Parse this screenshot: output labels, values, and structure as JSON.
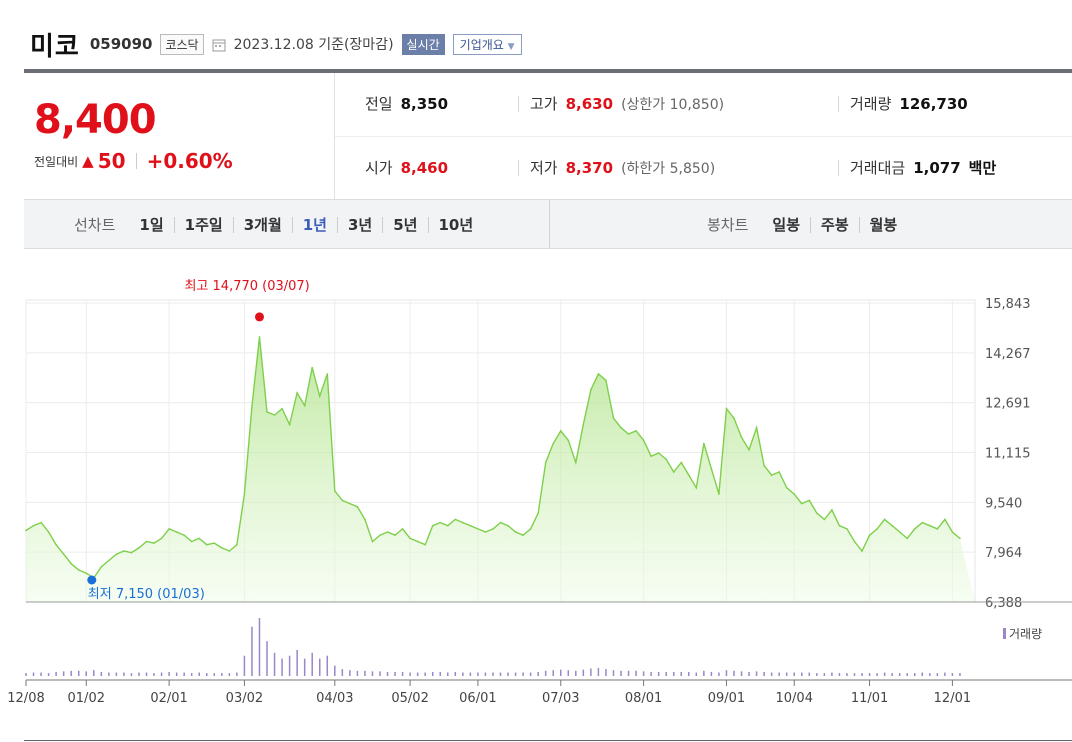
{
  "header": {
    "name": "미코",
    "code": "059090",
    "market": "코스닥",
    "date_text": "2023.12.08 기준(장마감)",
    "realtime_label": "실시간",
    "overview_label": "기업개요",
    "calendar_icon": "calendar-icon",
    "dropdown_icon": "chevron-down-icon"
  },
  "quote": {
    "price": "8,400",
    "change_label": "전일대비",
    "change_dir": "▲",
    "change": "50",
    "change_pct": "+0.60%",
    "prev_close_label": "전일",
    "prev_close": "8,350",
    "open_label": "시가",
    "open": "8,460",
    "high_label": "고가",
    "high": "8,630",
    "upper_limit": "(상한가 10,850)",
    "low_label": "저가",
    "low": "8,370",
    "lower_limit": "(하한가 5,850)",
    "volume_label": "거래량",
    "volume": "126,730",
    "value_label": "거래대금",
    "value": "1,077",
    "value_unit": "백만"
  },
  "tabs": {
    "line_label": "선차트",
    "line_periods": [
      "1일",
      "1주일",
      "3개월",
      "1년",
      "3년",
      "5년",
      "10년"
    ],
    "active_period": "1년",
    "candle_label": "봉차트",
    "candle_periods": [
      "일봉",
      "주봉",
      "월봉"
    ]
  },
  "colors": {
    "up": "#e0101a",
    "accent": "#3b5cb8",
    "line": "#7ed04a",
    "volume": "#9a86c8",
    "min_marker": "#1a6fd6"
  },
  "chart_data": {
    "type": "area",
    "y_ticks": [
      "15,843",
      "14,267",
      "12,691",
      "11,115",
      "9,540",
      "7,964",
      "6,388"
    ],
    "ylim": [
      6388,
      15843
    ],
    "x_tick_labels": [
      "12/08",
      "01/02",
      "02/01",
      "03/02",
      "04/03",
      "05/02",
      "06/01",
      "07/03",
      "08/01",
      "09/01",
      "10/04",
      "11/01",
      "12/01"
    ],
    "x": [
      "12/08",
      "12/12",
      "12/14",
      "12/16",
      "12/20",
      "12/22",
      "12/26",
      "12/28",
      "01/02",
      "01/03",
      "01/05",
      "01/09",
      "01/11",
      "01/13",
      "01/17",
      "01/19",
      "01/25",
      "01/27",
      "01/31",
      "02/02",
      "02/06",
      "02/08",
      "02/10",
      "02/14",
      "02/16",
      "02/20",
      "02/22",
      "02/24",
      "02/27",
      "03/02",
      "03/06",
      "03/07",
      "03/09",
      "03/13",
      "03/15",
      "03/17",
      "03/21",
      "03/23",
      "03/27",
      "03/29",
      "03/31",
      "04/04",
      "04/06",
      "04/10",
      "04/12",
      "04/14",
      "04/18",
      "04/20",
      "04/24",
      "04/26",
      "04/28",
      "05/03",
      "05/08",
      "05/10",
      "05/12",
      "05/16",
      "05/18",
      "05/22",
      "05/25",
      "05/30",
      "06/01",
      "06/05",
      "06/08",
      "06/12",
      "06/14",
      "06/16",
      "06/20",
      "06/22",
      "06/26",
      "06/28",
      "06/30",
      "07/03",
      "07/05",
      "07/07",
      "07/11",
      "07/13",
      "07/17",
      "07/19",
      "07/21",
      "07/25",
      "07/27",
      "07/31",
      "08/02",
      "08/04",
      "08/08",
      "08/10",
      "08/14",
      "08/17",
      "08/21",
      "08/23",
      "08/25",
      "08/29",
      "08/31",
      "09/04",
      "09/06",
      "09/08",
      "09/12",
      "09/14",
      "09/18",
      "09/20",
      "09/22",
      "09/26",
      "10/04",
      "10/06",
      "10/10",
      "10/12",
      "10/16",
      "10/18",
      "10/20",
      "10/24",
      "10/26",
      "10/30",
      "11/01",
      "11/03",
      "11/07",
      "11/09",
      "11/13",
      "11/15",
      "11/17",
      "11/21",
      "11/23",
      "11/27",
      "11/29",
      "12/01",
      "12/05",
      "12/07",
      "12/08"
    ],
    "series": [
      {
        "values": [
          8650,
          8800,
          8900,
          8600,
          8200,
          7900,
          7600,
          7400,
          7300,
          7150,
          7500,
          7700,
          7900,
          8000,
          7950,
          8100,
          8300,
          8250,
          8400,
          8700,
          8600,
          8500,
          8300,
          8400,
          8200,
          8250,
          8100,
          8000,
          8200,
          9800,
          12600,
          14770,
          12400,
          12300,
          12500,
          12000,
          13000,
          12600,
          13800,
          12900,
          13600,
          9900,
          9600,
          9500,
          9400,
          9000,
          8300,
          8500,
          8600,
          8500,
          8700,
          8400,
          8300,
          8200,
          8800,
          8900,
          8800,
          9000,
          8900,
          8800,
          8700,
          8600,
          8700,
          8900,
          8800,
          8600,
          8500,
          8700,
          9200,
          10800,
          11400,
          11800,
          11500,
          10800,
          12000,
          13100,
          13600,
          13400,
          12200,
          11900,
          11700,
          11800,
          11500,
          11000,
          11100,
          10900,
          10500,
          10800,
          10400,
          10000,
          11400,
          10600,
          9800,
          12500,
          12200,
          11600,
          11200,
          11900,
          10700,
          10400,
          10500,
          10000,
          9800,
          9500,
          9600,
          9200,
          9000,
          9300,
          8800,
          8700,
          8300,
          8000,
          8500,
          8700,
          9000,
          8800,
          8600,
          8400,
          8700,
          8900,
          8800,
          8700,
          9000,
          8600,
          8400
        ]
      }
    ],
    "volume_series_name": "거래량",
    "volume_values": [
      5,
      6,
      6,
      5,
      7,
      8,
      9,
      9,
      8,
      10,
      7,
      6,
      6,
      6,
      5,
      6,
      6,
      5,
      6,
      7,
      6,
      6,
      5,
      6,
      5,
      5,
      5,
      5,
      6,
      35,
      85,
      100,
      60,
      40,
      30,
      35,
      45,
      30,
      40,
      30,
      35,
      18,
      12,
      10,
      9,
      9,
      8,
      8,
      7,
      7,
      7,
      6,
      6,
      6,
      7,
      7,
      6,
      7,
      6,
      6,
      6,
      6,
      6,
      6,
      6,
      6,
      6,
      6,
      7,
      9,
      10,
      11,
      10,
      9,
      11,
      13,
      14,
      12,
      10,
      9,
      9,
      9,
      8,
      7,
      7,
      7,
      7,
      7,
      7,
      6,
      9,
      7,
      6,
      10,
      9,
      8,
      7,
      8,
      7,
      6,
      6,
      6,
      6,
      6,
      6,
      5,
      5,
      6,
      5,
      5,
      5,
      5,
      5,
      5,
      6,
      5,
      5,
      5,
      5,
      6,
      5,
      5,
      6,
      5,
      5
    ],
    "max_annotation": "최고 14,770 (03/07)",
    "min_annotation": "최저 7,150 (01/03)"
  }
}
